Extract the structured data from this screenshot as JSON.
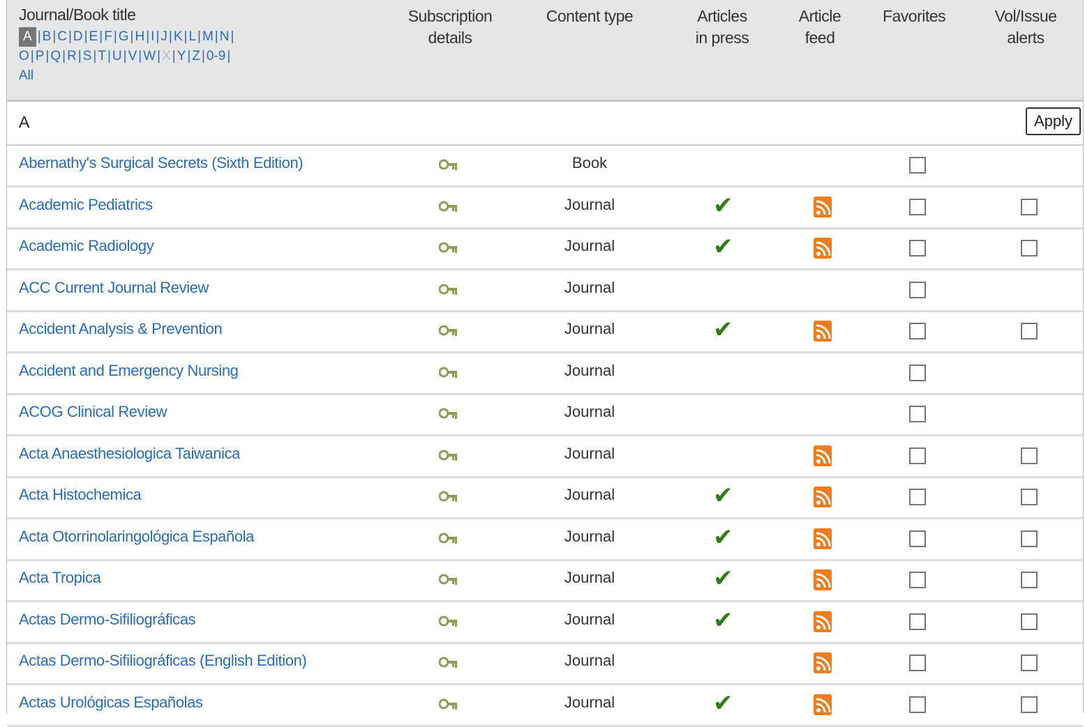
{
  "header": {
    "title_col": "Journal/Book title",
    "subscription_col_1": "Subscription",
    "subscription_col_2": "details",
    "content_type_col": "Content type",
    "articles_in_press_1": "Articles",
    "articles_in_press_2": "in press",
    "article_feed_1": "Article",
    "article_feed_2": "feed",
    "favorites_col": "Favorites",
    "alerts_col_1": "Vol/Issue",
    "alerts_col_2": "alerts"
  },
  "alphabet": {
    "line1": [
      "A",
      "B",
      "C",
      "D",
      "E",
      "F",
      "G",
      "H",
      "I",
      "J",
      "K",
      "L",
      "M",
      "N"
    ],
    "line2": [
      "O",
      "P",
      "Q",
      "R",
      "S",
      "T",
      "U",
      "V",
      "W",
      "X",
      "Y",
      "Z",
      "0-9"
    ],
    "selected": "A",
    "disabled": [
      "X"
    ],
    "all": "All"
  },
  "section": {
    "letter": "A",
    "apply_label": "Apply"
  },
  "icons": {
    "subscription": "key-icon",
    "in_press": "checkmark-icon",
    "feed": "rss-feed-icon"
  },
  "colors": {
    "link": "#2b6cb8",
    "check": "#2e7d16",
    "rss": "#f07c1e",
    "key": "#8aa05a"
  },
  "rows": [
    {
      "title": "Abernathy's Surgical Secrets (Sixth Edition)",
      "type": "Book",
      "in_press": false,
      "feed": false,
      "alerts": false
    },
    {
      "title": "Academic Pediatrics",
      "type": "Journal",
      "in_press": true,
      "feed": true,
      "alerts": true
    },
    {
      "title": "Academic Radiology",
      "type": "Journal",
      "in_press": true,
      "feed": true,
      "alerts": true
    },
    {
      "title": "ACC Current Journal Review",
      "type": "Journal",
      "in_press": false,
      "feed": false,
      "alerts": false
    },
    {
      "title": "Accident Analysis & Prevention",
      "type": "Journal",
      "in_press": true,
      "feed": true,
      "alerts": true
    },
    {
      "title": "Accident and Emergency Nursing",
      "type": "Journal",
      "in_press": false,
      "feed": false,
      "alerts": false
    },
    {
      "title": "ACOG Clinical Review",
      "type": "Journal",
      "in_press": false,
      "feed": false,
      "alerts": false
    },
    {
      "title": "Acta Anaesthesiologica Taiwanica",
      "type": "Journal",
      "in_press": false,
      "feed": true,
      "alerts": true
    },
    {
      "title": "Acta Histochemica",
      "type": "Journal",
      "in_press": true,
      "feed": true,
      "alerts": true
    },
    {
      "title": "Acta Otorrinolaringológica Española",
      "type": "Journal",
      "in_press": true,
      "feed": true,
      "alerts": true
    },
    {
      "title": "Acta Tropica",
      "type": "Journal",
      "in_press": true,
      "feed": true,
      "alerts": true
    },
    {
      "title": "Actas Dermo-Sifiliográficas",
      "type": "Journal",
      "in_press": true,
      "feed": true,
      "alerts": true
    },
    {
      "title": "Actas Dermo-Sifiliográficas (English Edition)",
      "type": "Journal",
      "in_press": false,
      "feed": true,
      "alerts": true
    },
    {
      "title": "Actas Urológicas Españolas",
      "type": "Journal",
      "in_press": true,
      "feed": true,
      "alerts": true
    }
  ]
}
